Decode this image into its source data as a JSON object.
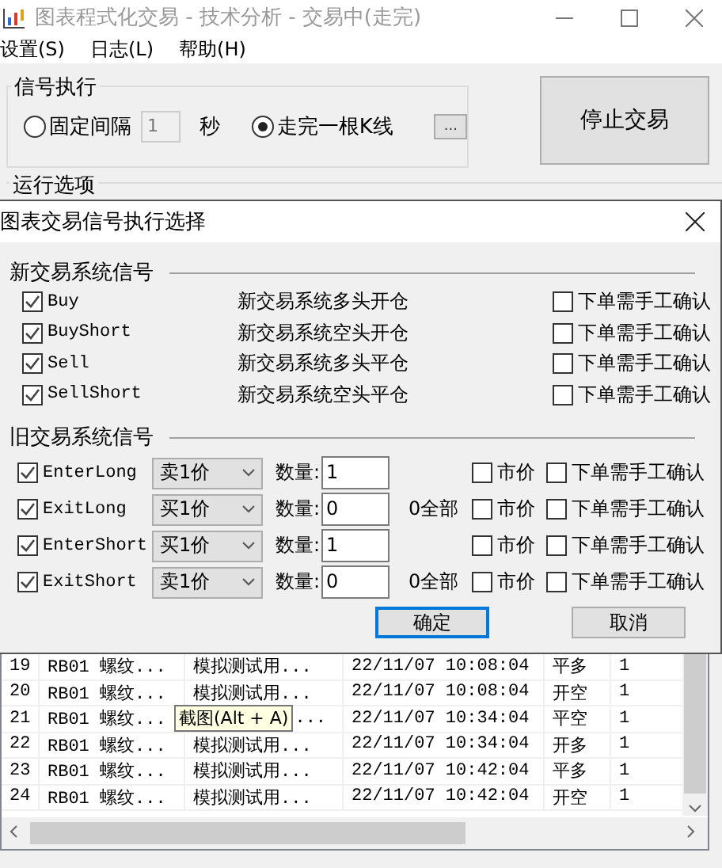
{
  "window": {
    "title": "图表程式化交易 - 技术分析 - 交易中(走完)"
  },
  "menu": [
    "设置(S)",
    "日志(L)",
    "帮助(H)"
  ],
  "signal_execution": {
    "title": "信号执行",
    "options": [
      {
        "label": "固定间隔",
        "selected": false
      },
      {
        "label": "走完一根K线",
        "selected": true
      }
    ],
    "interval": {
      "value": "1",
      "disabled": true
    },
    "unit": "秒",
    "more_button": "..."
  },
  "stop_button": "停止交易",
  "run_options": {
    "title": "运行选项"
  },
  "dialog": {
    "title": "图表交易信号执行选择",
    "new_section": {
      "title": "新交易系统信号",
      "signals": [
        {
          "name": "Buy",
          "checked": true,
          "description": "新交易系统多头开仓",
          "confirm": {
            "label": "下单需手工确认",
            "checked": false
          }
        },
        {
          "name": "BuyShort",
          "checked": true,
          "description": "新交易系统空头开仓",
          "confirm": {
            "label": "下单需手工确认",
            "checked": false
          }
        },
        {
          "name": "Sell",
          "checked": true,
          "description": "新交易系统多头平仓",
          "confirm": {
            "label": "下单需手工确认",
            "checked": false
          }
        },
        {
          "name": "SellShort",
          "checked": true,
          "description": "新交易系统空头平仓",
          "confirm": {
            "label": "下单需手工确认",
            "checked": false
          }
        }
      ]
    },
    "old_section": {
      "title": "旧交易系统信号",
      "signals": [
        {
          "name": "EnterLong",
          "checked": true,
          "price": "卖1价",
          "quantity_label": "数量:",
          "quantity": "1",
          "market": {
            "label": "市价",
            "checked": false
          },
          "confirm": {
            "label": "下单需手工确认",
            "checked": false
          }
        },
        {
          "name": "ExitLong",
          "checked": true,
          "price": "买1价",
          "quantity_label": "数量:",
          "quantity": "0",
          "note": "0全部",
          "market": {
            "label": "市价",
            "checked": false
          },
          "confirm": {
            "label": "下单需手工确认",
            "checked": false
          }
        },
        {
          "name": "EnterShort",
          "checked": true,
          "price": "买1价",
          "quantity_label": "数量:",
          "quantity": "1",
          "market": {
            "label": "市价",
            "checked": false
          },
          "confirm": {
            "label": "下单需手工确认",
            "checked": false
          }
        },
        {
          "name": "ExitShort",
          "checked": true,
          "price": "卖1价",
          "quantity_label": "数量:",
          "quantity": "0",
          "note": "0全部",
          "market": {
            "label": "市价",
            "checked": false
          },
          "confirm": {
            "label": "下单需手工确认",
            "checked": false
          }
        }
      ]
    },
    "buttons": [
      {
        "label": "确定",
        "focused": true
      },
      {
        "label": "取消",
        "focused": false
      }
    ]
  },
  "table": {
    "rows": [
      {
        "cells": [
          "19",
          "RB01 螺纹...",
          "模拟测试用...",
          "22/11/07 10:08:04",
          "平多",
          "1"
        ]
      },
      {
        "cells": [
          "20",
          "RB01 螺纹...",
          "模拟测试用...",
          "22/11/07 10:08:04",
          "开空",
          "1"
        ]
      },
      {
        "cells": [
          "21",
          "RB01 螺纹...",
          "...",
          "22/11/07 10:34:04",
          "平空",
          "1"
        ],
        "tooltip": "截图(Alt + A)"
      },
      {
        "cells": [
          "22",
          "RB01 螺纹...",
          "模拟测试用...",
          "22/11/07 10:34:04",
          "开多",
          "1"
        ]
      },
      {
        "cells": [
          "23",
          "RB01 螺纹...",
          "模拟测试用...",
          "22/11/07 10:42:04",
          "平多",
          "1"
        ]
      },
      {
        "cells": [
          "24",
          "RB01 螺纹...",
          "模拟测试用...",
          "22/11/07 10:42:04",
          "开空",
          "1"
        ]
      }
    ]
  }
}
